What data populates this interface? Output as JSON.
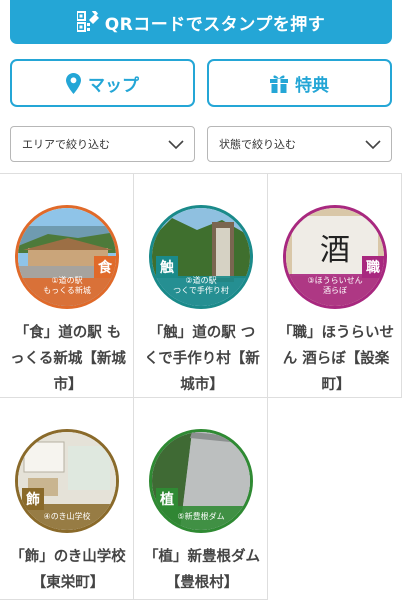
{
  "actions": {
    "qr_label": "QRコードでスタンプを押す",
    "map_label": "マップ",
    "perk_label": "特典"
  },
  "filters": {
    "area_label": "エリアで絞り込む",
    "state_label": "状態で絞り込む"
  },
  "colors": {
    "primary": "#24a6d6",
    "shoku_food": "#e06a2a",
    "shoku_touch": "#1a8a8a",
    "shoku_craft": "#a8287f",
    "kazaru": "#8a6a2a",
    "ueru": "#2f8a33"
  },
  "spots": [
    {
      "title": "「食」道の駅 もっくる新城【新城市】",
      "caption_line1": "①道の駅",
      "caption_line2": "もっくる新城",
      "badge": "食",
      "icon": "wooden-station-photo"
    },
    {
      "title": "「触」道の駅 つくで手作り村【新城市】",
      "caption_line1": "②道の駅",
      "caption_line2": "つくで手作り村",
      "badge": "触",
      "icon": "wooden-sign-photo"
    },
    {
      "title": "「職」ほうらいせん 酒らぼ【設楽町】",
      "caption_line1": "③ほうらいせん",
      "caption_line2": "酒らぼ",
      "badge": "職",
      "icon": "sake-lab-photo"
    },
    {
      "title": "「飾」のき山学校【東栄町】",
      "caption_line1": "④のき山学校",
      "caption_line2": "",
      "badge": "飾",
      "icon": "school-classroom-photo"
    },
    {
      "title": "「植」新豊根ダム【豊根村】",
      "caption_line1": "⑤新豊根ダム",
      "caption_line2": "",
      "badge": "植",
      "icon": "dam-photo"
    }
  ]
}
